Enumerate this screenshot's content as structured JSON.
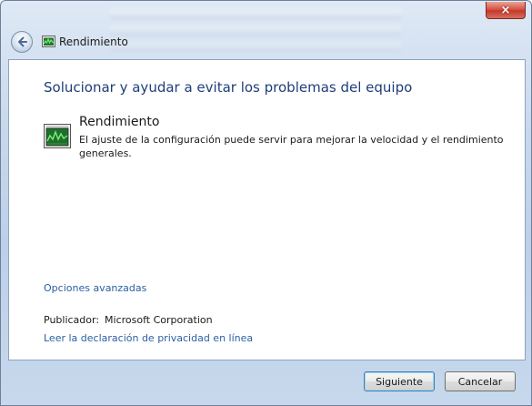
{
  "window": {
    "title": "Rendimiento",
    "close_label": "×"
  },
  "content": {
    "heading": "Solucionar y ayudar a evitar los problemas del equipo",
    "task": {
      "title": "Rendimiento",
      "description": "El ajuste de la configuración puede servir para mejorar la velocidad y el rendimiento generales.",
      "icon": "performance-monitor-icon"
    },
    "advanced_link": "Opciones avanzadas",
    "publisher_label": "Publicador:",
    "publisher_value": "Microsoft Corporation",
    "privacy_link": "Leer la declaración de privacidad en línea"
  },
  "footer": {
    "next_label": "Siguiente",
    "cancel_label": "Cancelar"
  },
  "colors": {
    "heading": "#1e3f78",
    "link": "#2a5fa3",
    "close": "#c23a2b"
  }
}
